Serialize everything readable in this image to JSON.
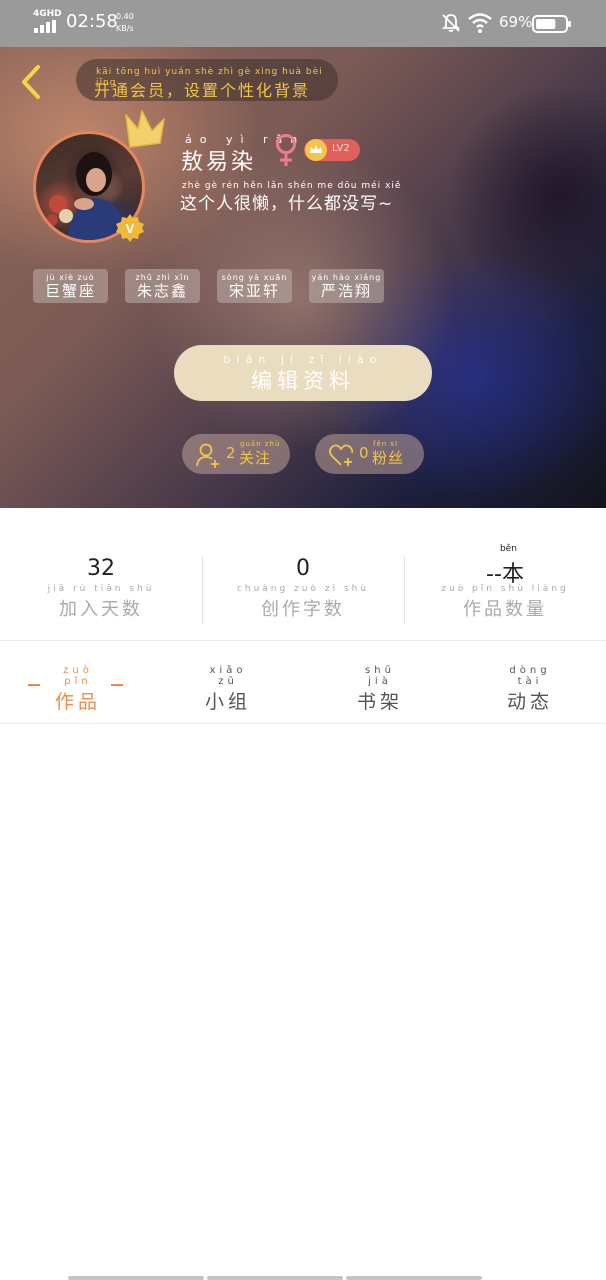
{
  "status_bar": {
    "network": "4GHD",
    "time": "02:58",
    "speed_value": "0.40",
    "speed_unit": "KB/s",
    "battery_percent": "69%",
    "battery_level": 0.69
  },
  "vip_banner": {
    "pinyin": "kāi tōng huì yuán   shè zhì gè xìng huà bèi jǐng",
    "text": "开通会员，设置个性化背景"
  },
  "profile": {
    "name_pinyin": "áo yì rǎn",
    "name": "敖易染",
    "level": "LV2",
    "bio_pinyin": "zhè gè rén hěn lǎn   shén me dōu méi xiě",
    "bio": "这个人很懒，什么都没写~",
    "verified_badge": "V"
  },
  "tags": [
    {
      "pinyin": "jù xiè zuò",
      "text": "巨蟹座"
    },
    {
      "pinyin": "zhū zhì xīn",
      "text": "朱志鑫"
    },
    {
      "pinyin": "sòng yà xuān",
      "text": "宋亚轩"
    },
    {
      "pinyin": "yán hào xiáng",
      "text": "严浩翔"
    }
  ],
  "edit_button": {
    "pinyin": "biān jí zī liào",
    "text": "编辑资料"
  },
  "follow": {
    "count": "2",
    "pinyin": "guān zhù",
    "text": "关注"
  },
  "fans": {
    "count": "0",
    "pinyin": "fěn sī",
    "text": "粉丝"
  },
  "stats": [
    {
      "value": "32",
      "label_pinyin": "jiā rù tiān shù",
      "label": "加入天数"
    },
    {
      "value": "0",
      "label_pinyin": "chuàng zuò zì shù",
      "label": "创作字数"
    },
    {
      "value": "--",
      "unit": "本",
      "unit_pinyin": "běn",
      "label_pinyin": "zuò pǐn shù liàng",
      "label": "作品数量"
    }
  ],
  "tabs": [
    {
      "pinyin": "zuò pǐn",
      "text": "作品",
      "active": true
    },
    {
      "pinyin": "xiǎo zǔ",
      "text": "小组",
      "active": false
    },
    {
      "pinyin": "shū jià",
      "text": "书架",
      "active": false
    },
    {
      "pinyin": "dòng tài",
      "text": "动态",
      "active": false
    }
  ],
  "colors": {
    "accent_orange": "#ef8a4c",
    "gold": "#f5c542",
    "level_badge": "#e0605c",
    "edit_button": "#e9dcbf"
  },
  "icons": [
    "back-arrow-icon",
    "crown-icon",
    "female-icon",
    "follow-user-icon",
    "heart-plus-icon",
    "bell-muted-icon",
    "wifi-icon",
    "battery-icon"
  ]
}
